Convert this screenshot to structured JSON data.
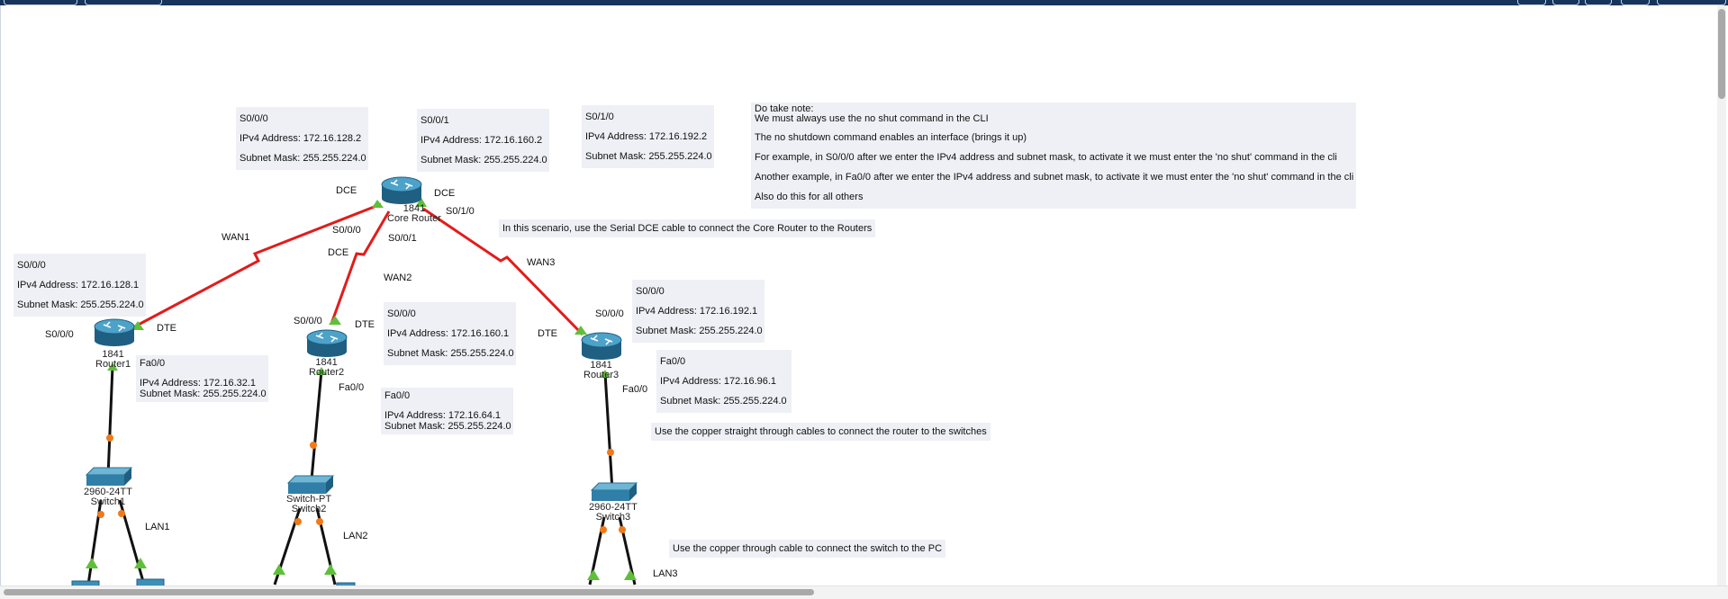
{
  "notes": {
    "core_s000": [
      "S0/0/0",
      "IPv4 Address: 172.16.128.2",
      "Subnet Mask: 255.255.224.0"
    ],
    "core_s001": [
      "S0/0/1",
      "IPv4 Address: 172.16.160.2",
      "Subnet Mask: 255.255.224.0"
    ],
    "core_s010": [
      "S0/1/0",
      "IPv4 Address: 172.16.192.2",
      "Subnet Mask: 255.255.224.0"
    ],
    "r1_s000": [
      "S0/0/0",
      "IPv4 Address: 172.16.128.1",
      "Subnet Mask: 255.255.224.0"
    ],
    "r1_fa00": [
      "Fa0/0",
      "IPv4 Address:  172.16.32.1",
      "Subnet Mask: 255.255.224.0"
    ],
    "r2_s000": [
      "S0/0/0",
      "IPv4 Address: 172.16.160.1",
      "Subnet Mask: 255.255.224.0"
    ],
    "r2_fa00": [
      "Fa0/0",
      "IPv4 Address:  172.16.64.1",
      "Subnet Mask: 255.255.224.0"
    ],
    "r3_s000": [
      "S0/0/0",
      "IPv4 Address: 172.16.192.1",
      "Subnet Mask: 255.255.224.0"
    ],
    "r3_fa00": [
      "Fa0/0",
      "IPv4 Address: 172.16.96.1",
      "Subnet Mask: 255.255.224.0"
    ],
    "take_note": [
      "Do take note:",
      "We must always use the no shut command in the CLI",
      "The no shutdown command enables an interface (brings it up)",
      "For example, in S0/0/0 after we enter the IPv4 address and subnet mask, to activate it we must enter the 'no shut' command in the cli",
      "Another example, in Fa0/0 after we enter the IPv4 address and subnet mask, to activate it we must enter the 'no shut' command in the cli",
      "Also do this for all others"
    ],
    "serial_hint": "In this scenario, use the Serial DCE cable to connect the Core Router to the Routers",
    "copper_router_hint": "Use the copper straight through cables to connect the router to the switches",
    "copper_switch_hint": "Use the copper through cable to connect the switch to the PC"
  },
  "labels": {
    "wan1": "WAN1",
    "wan2": "WAN2",
    "wan3": "WAN3",
    "lan1": "LAN1",
    "lan2": "LAN2",
    "lan3": "LAN3",
    "dce": "DCE",
    "dte": "DTE",
    "s000": "S0/0/0",
    "s001": "S0/0/1",
    "s010": "S0/1/0",
    "fa00": "Fa0/0"
  },
  "devices": {
    "core": {
      "model": "1841",
      "name": "Core Router"
    },
    "router1": {
      "model": "1841",
      "name": "Router1"
    },
    "router2": {
      "model": "1841",
      "name": "Router2"
    },
    "router3": {
      "model": "1841",
      "name": "Router3"
    },
    "switch1": {
      "model": "2960-24TT",
      "name": "Switch1"
    },
    "switch2": {
      "model": "Switch-PT",
      "name": "Switch2"
    },
    "switch3": {
      "model": "2960-24TT",
      "name": "Switch3"
    }
  },
  "colors": {
    "serial": "#e31b1b",
    "copper": "#111111",
    "port_up": "#5fbf3a",
    "port_pending": "#f07a1a",
    "note_bg": "#eef0f5",
    "router": "#2f7fa8"
  }
}
